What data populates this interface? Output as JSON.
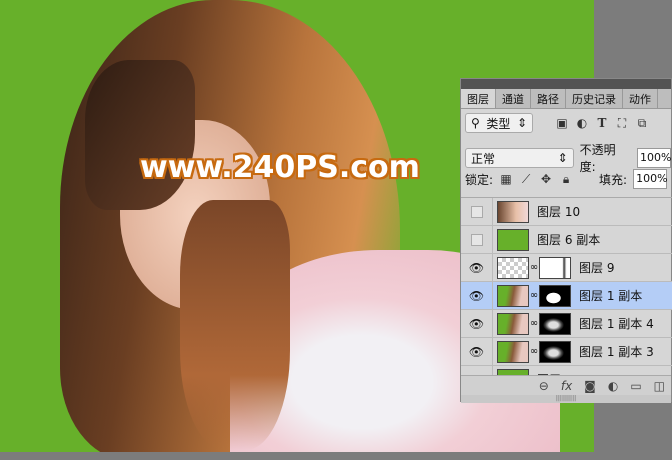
{
  "watermark": "www.240PS.com",
  "colors": {
    "canvas_bg": "#67b02a",
    "selected_layer": "#b4cdf6",
    "watermark_outline": "#c76a10"
  },
  "panel": {
    "tabs": [
      {
        "label": "图层",
        "active": true
      },
      {
        "label": "通道"
      },
      {
        "label": "路径"
      },
      {
        "label": "历史记录"
      },
      {
        "label": "动作"
      }
    ],
    "filter": {
      "icon": "search-icon",
      "label": "类型"
    },
    "filter_icons": [
      "image-icon",
      "adjustment-icon",
      "type-icon",
      "shape-icon",
      "smart-object-icon"
    ],
    "blend_mode": "正常",
    "opacity_label": "不透明度:",
    "opacity_value": "100%",
    "lock_label": "锁定:",
    "fill_label": "填充:",
    "fill_value": "100%",
    "layers": [
      {
        "name": "图层 10",
        "visible": false,
        "thumb": "photo",
        "mask": null
      },
      {
        "name": "图层 6 副本",
        "visible": false,
        "thumb": "green",
        "mask": null
      },
      {
        "name": "图层 9",
        "visible": true,
        "thumb": "transparent",
        "mask": "white"
      },
      {
        "name": "图层 1 副本",
        "visible": true,
        "thumb": "photo-green",
        "mask": "black-white",
        "selected": true
      },
      {
        "name": "图层 1 副本 4",
        "visible": true,
        "thumb": "photo-green",
        "mask": "hair"
      },
      {
        "name": "图层 1 副本 3",
        "visible": true,
        "thumb": "photo-green",
        "mask": "hair"
      },
      {
        "name": "图层",
        "visible": true,
        "thumb": "green",
        "mask": null
      }
    ],
    "bottom_icons": [
      "link-icon",
      "fx-icon",
      "mask-icon",
      "adjustment-icon",
      "folder-icon",
      "new-layer-icon"
    ]
  }
}
